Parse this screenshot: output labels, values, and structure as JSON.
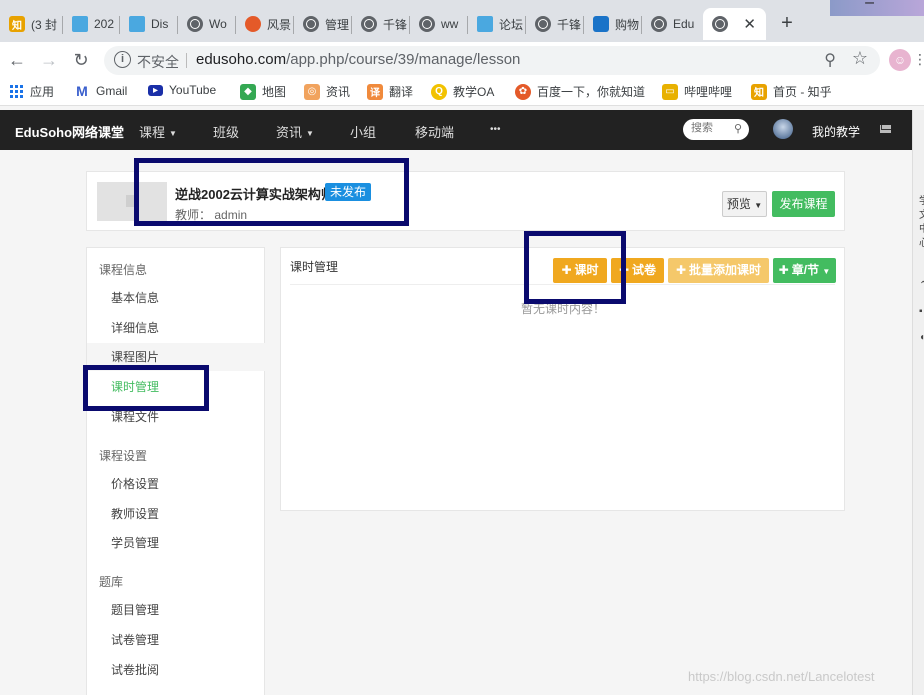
{
  "browser": {
    "tabs": [
      {
        "icon": "zhihu-icon",
        "label": "(3 封"
      },
      {
        "icon": "bird-icon",
        "label": "202"
      },
      {
        "icon": "bird-icon",
        "label": "Dis"
      },
      {
        "icon": "globe-icon",
        "label": "Wo"
      },
      {
        "icon": "paw-icon",
        "label": "风景"
      },
      {
        "icon": "globe-icon",
        "label": "管理"
      },
      {
        "icon": "globe-icon",
        "label": "千锋"
      },
      {
        "icon": "globe-icon",
        "label": "ww"
      },
      {
        "icon": "bird-icon",
        "label": "论坛"
      },
      {
        "icon": "globe-icon",
        "label": "千锋"
      },
      {
        "icon": "cart-icon",
        "label": "购物"
      },
      {
        "icon": "globe-icon",
        "label": "Edu"
      },
      {
        "icon": "globe-icon",
        "label": ""
      }
    ],
    "address": {
      "insecure_label": "不安全",
      "host": "edusoho.com",
      "path": "/app.php/course/39/manage/lesson"
    },
    "bookmarks": [
      {
        "label": "应用"
      },
      {
        "label": "Gmail"
      },
      {
        "label": "YouTube"
      },
      {
        "label": "地图"
      },
      {
        "label": "资讯"
      },
      {
        "label": "翻译"
      },
      {
        "label": "教学OA"
      },
      {
        "label": "百度一下，你就知道"
      },
      {
        "label": "哔哩哔哩"
      },
      {
        "label": "首页 - 知乎"
      }
    ]
  },
  "site": {
    "logo": "EduSoho网络课堂",
    "nav": [
      "课程",
      "班级",
      "资讯",
      "小组",
      "移动端",
      "•••"
    ],
    "search_placeholder": "搜索",
    "user_menu": "我的教学"
  },
  "course": {
    "title": "逆战2002云计算实战架构师",
    "status": "未发布",
    "teacher_label": "教师：",
    "teacher": "admin",
    "preview_label": "预览",
    "publish_label": "发布课程"
  },
  "sidebar": {
    "groups": [
      {
        "title": "课程信息",
        "items": [
          "基本信息",
          "详细信息",
          "课程图片",
          "课时管理",
          "课程文件"
        ]
      },
      {
        "title": "课程设置",
        "items": [
          "价格设置",
          "教师设置",
          "学员管理"
        ]
      },
      {
        "title": "题库",
        "items": [
          "题目管理",
          "试卷管理",
          "试卷批阅"
        ]
      }
    ]
  },
  "main": {
    "title": "课时管理",
    "buttons": {
      "add_lesson": "课时",
      "add_testpaper": "试卷",
      "batch_add": "批量添加课时",
      "chapter": "章/节"
    },
    "empty_text": "暂无课时内容！"
  },
  "watermark": "https://blog.csdn.net/Lancelotest",
  "colors": {
    "header_bg": "#222222",
    "accent_green": "#43bc60",
    "accent_orange": "#f0a81f",
    "badge_blue": "#1a8fe0",
    "annotation_navy": "#0a0a6e"
  }
}
